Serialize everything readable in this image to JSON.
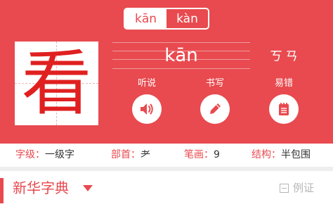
{
  "pinyin_tabs": [
    {
      "label": "kān",
      "active": true
    },
    {
      "label": "kàn",
      "active": false
    }
  ],
  "character": "看",
  "reading": "kān",
  "zhuyin": "ㄎㄢ",
  "actions": [
    {
      "label": "听说",
      "icon": "speaker-icon"
    },
    {
      "label": "书写",
      "icon": "pencil-icon"
    },
    {
      "label": "易错",
      "icon": "notepad-icon"
    }
  ],
  "info": {
    "level_key": "字级：",
    "level_val": "一级字",
    "radical_key": "部首：",
    "radical_val": "⺹",
    "strokes_key": "笔画：",
    "strokes_val": "9",
    "structure_key": "结构：",
    "structure_val": "半包围"
  },
  "section": {
    "title": "新华字典",
    "examples_label": "例证"
  },
  "colors": {
    "brand": "#e84a4f",
    "glyph": "#e02020"
  }
}
